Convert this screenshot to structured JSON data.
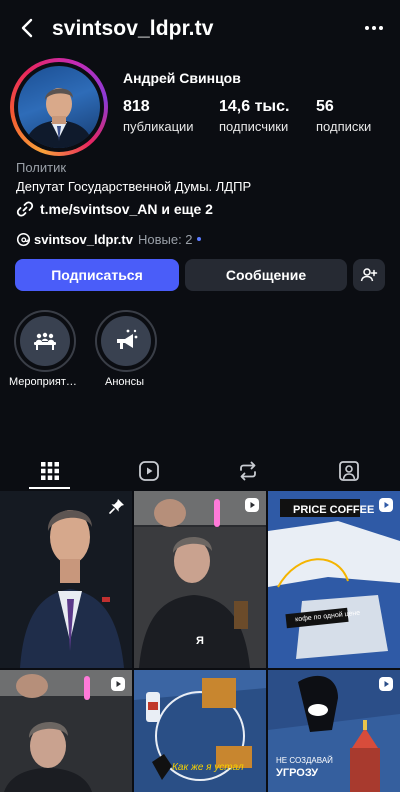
{
  "header": {
    "username": "svintsov_ldpr.tv",
    "back_icon": "chevron-left-icon",
    "more_icon": "more-horizontal-icon"
  },
  "profile": {
    "full_name": "Андрей Свинцов",
    "stats": [
      {
        "value": "818",
        "label": "публикации"
      },
      {
        "value": "14,6 тыс.",
        "label": "подписчики"
      },
      {
        "value": "56",
        "label": "подписки"
      }
    ],
    "category": "Политик",
    "bio": "Депутат Государственной Думы. ЛДПР",
    "link": "t.me/svintsov_AN и еще 2",
    "threads_username": "svintsov_ldpr.tv",
    "threads_new": "Новые: 2"
  },
  "actions": {
    "follow_label": "Подписаться",
    "message_label": "Сообщение"
  },
  "highlights": [
    {
      "label": "Мероприят…",
      "icon": "table-event-icon"
    },
    {
      "label": "Анонсы",
      "icon": "megaphone-icon"
    }
  ],
  "tabs": [
    {
      "name": "grid",
      "icon": "grid-icon",
      "active": true
    },
    {
      "name": "reels",
      "icon": "reels-icon",
      "active": false
    },
    {
      "name": "reposts",
      "icon": "repost-icon",
      "active": false
    },
    {
      "name": "tagged",
      "icon": "tagged-user-icon",
      "active": false
    }
  ],
  "grid_posts": {
    "post_3_sticker_title": "PRICE COFFEE",
    "post_3_sticker_text": "кофе по одной цене",
    "post_5_caption": "Как же я устал",
    "post_6_caption_1": "НЕ СОЗДАВАЙ",
    "post_6_caption_2": "УГРОЗУ",
    "post_2_letter": "Я"
  },
  "colors": {
    "background": "#0b0d12",
    "primary_button": "#4a5df9",
    "secondary_button": "#262a33",
    "muted_text": "#9aa0a8"
  }
}
